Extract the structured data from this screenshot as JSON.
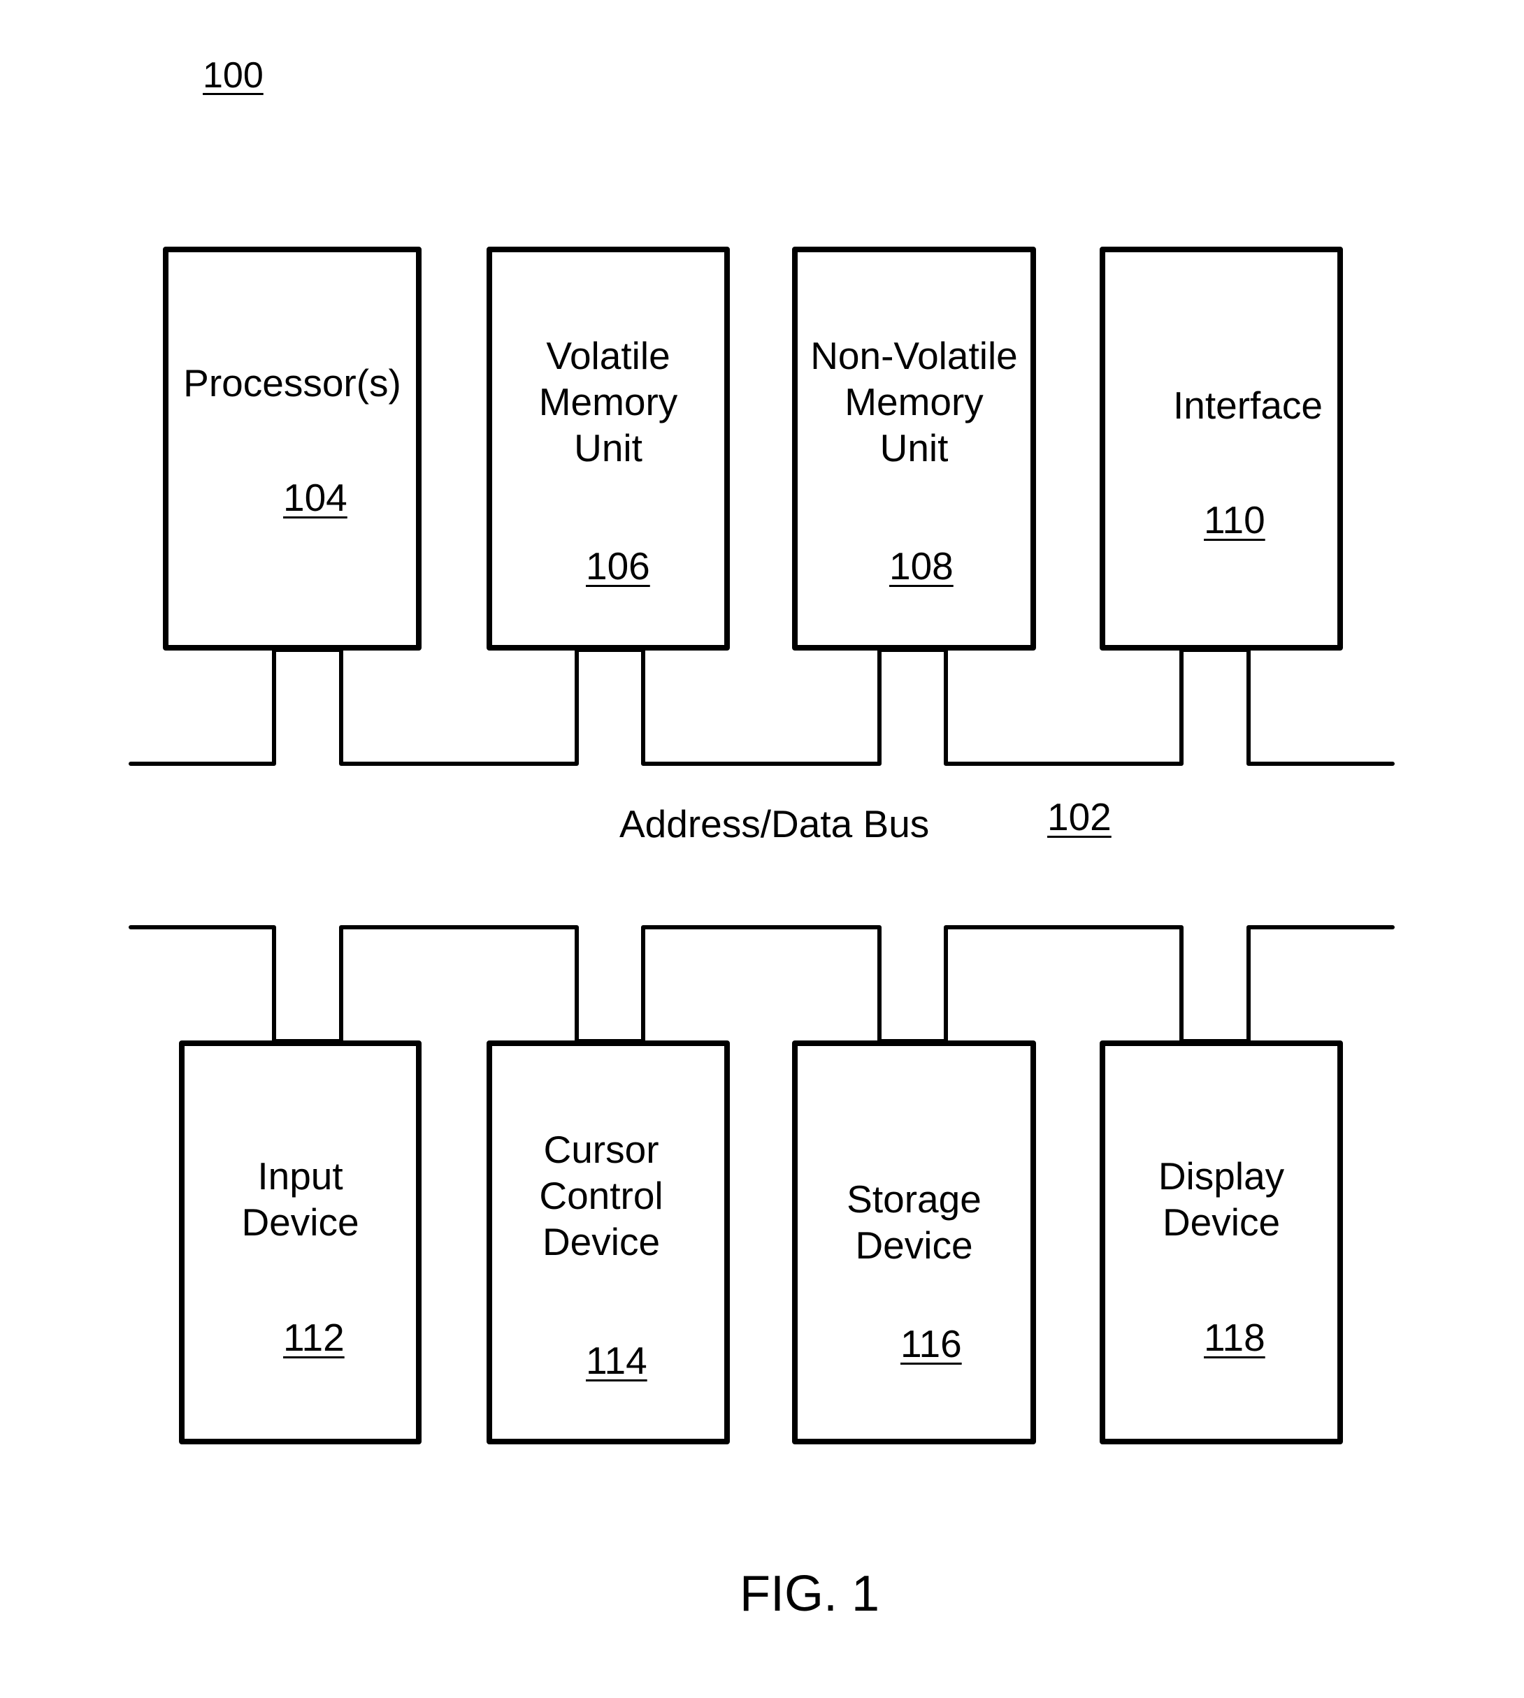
{
  "figure": {
    "ref": "100",
    "caption": "FIG. 1"
  },
  "bus": {
    "label": "Address/Data Bus",
    "ref": "102"
  },
  "top_row": [
    {
      "id": "processor",
      "label": "Processor(s)",
      "ref": "104"
    },
    {
      "id": "volatile-memory",
      "label": "Volatile\nMemory\nUnit",
      "ref": "106"
    },
    {
      "id": "non-volatile-memory",
      "label": "Non-Volatile\nMemory\nUnit",
      "ref": "108"
    },
    {
      "id": "interface",
      "label": "Interface",
      "ref": "110"
    }
  ],
  "bottom_row": [
    {
      "id": "input-device",
      "label": "Input\nDevice",
      "ref": "112"
    },
    {
      "id": "cursor-control-device",
      "label": "Cursor\nControl\nDevice",
      "ref": "114"
    },
    {
      "id": "storage-device",
      "label": "Storage\nDevice",
      "ref": "116"
    },
    {
      "id": "display-device",
      "label": "Display\nDevice",
      "ref": "118"
    }
  ]
}
